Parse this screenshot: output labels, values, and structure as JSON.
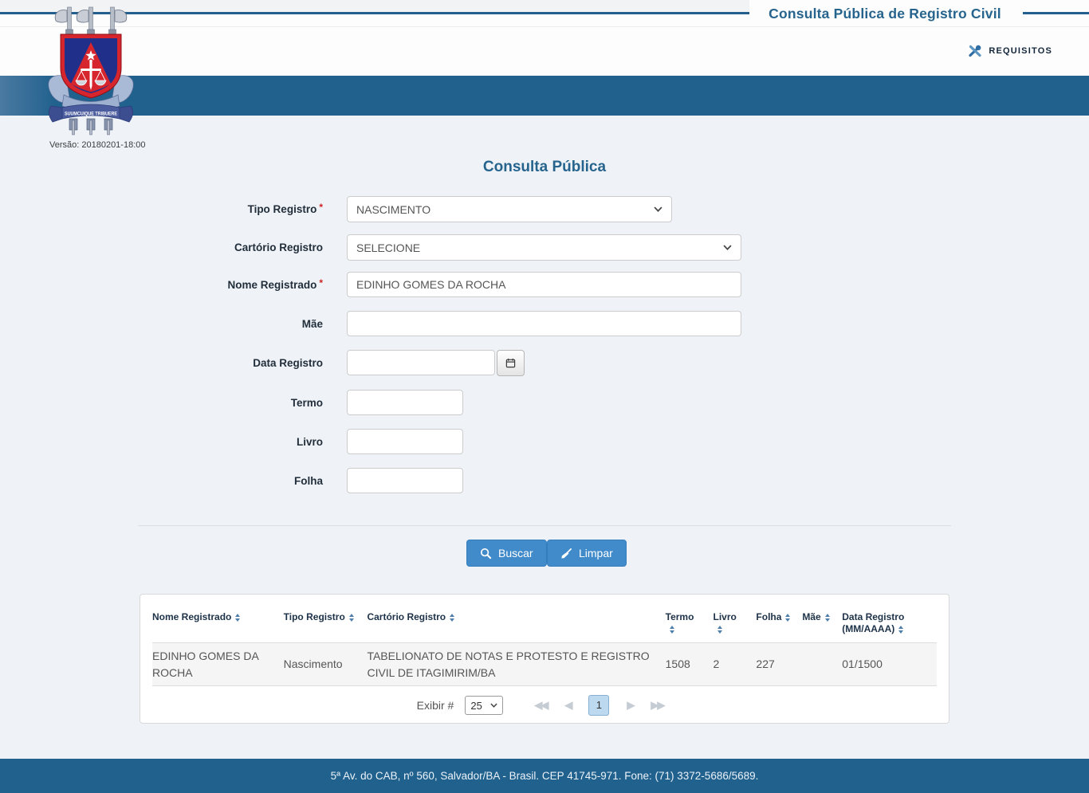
{
  "header": {
    "page_title": "Consulta Pública de Registro Civil",
    "requisitos_label": "REQUISITOS",
    "version": "Versão: 20180201-18:00",
    "logo_motto": "SUUMCUIQUE TRIBUERE"
  },
  "form": {
    "title": "Consulta Pública",
    "fields": {
      "tipo_registro": {
        "label": "Tipo Registro",
        "required": "*",
        "value": "NASCIMENTO"
      },
      "cartorio_registro": {
        "label": "Cartório Registro",
        "value": "SELECIONE"
      },
      "nome_registrado": {
        "label": "Nome Registrado",
        "required": "*",
        "value": "EDINHO GOMES DA ROCHA"
      },
      "mae": {
        "label": "Mãe",
        "value": ""
      },
      "data_registro": {
        "label": "Data Registro",
        "value": ""
      },
      "termo": {
        "label": "Termo",
        "value": ""
      },
      "livro": {
        "label": "Livro",
        "value": ""
      },
      "folha": {
        "label": "Folha",
        "value": ""
      }
    },
    "buttons": {
      "buscar": "Buscar",
      "limpar": "Limpar"
    }
  },
  "results": {
    "columns": [
      "Nome Registrado",
      "Tipo Registro",
      "Cartório Registro",
      "Termo",
      "Livro",
      "Folha",
      "Mãe",
      "Data Registro (MM/AAAA)"
    ],
    "rows": [
      [
        "EDINHO GOMES DA ROCHA",
        "Nascimento",
        "TABELIONATO DE NOTAS E PROTESTO E REGISTRO CIVIL DE ITAGIMIRIM/BA",
        "1508",
        "2",
        "227",
        "",
        "01/1500"
      ]
    ],
    "pagination": {
      "exibir_label": "Exibir #",
      "page_size": "25",
      "current_page": "1",
      "icons": {
        "first": "◀◀",
        "prev": "◀",
        "next": "▶",
        "last": "▶▶"
      }
    }
  },
  "footer": {
    "address": "5ª Av. do CAB, nº 560, Salvador/BA - Brasil. CEP 41745-971. Fone: (71) 3372-5686/5689."
  },
  "colors": {
    "band_blue": "#21618e",
    "title_blue": "#26648e",
    "button_blue": "#428bca",
    "page_bg": "#eff3f8",
    "required_red": "#cc2222",
    "active_page_bg": "#bdd9ef"
  }
}
